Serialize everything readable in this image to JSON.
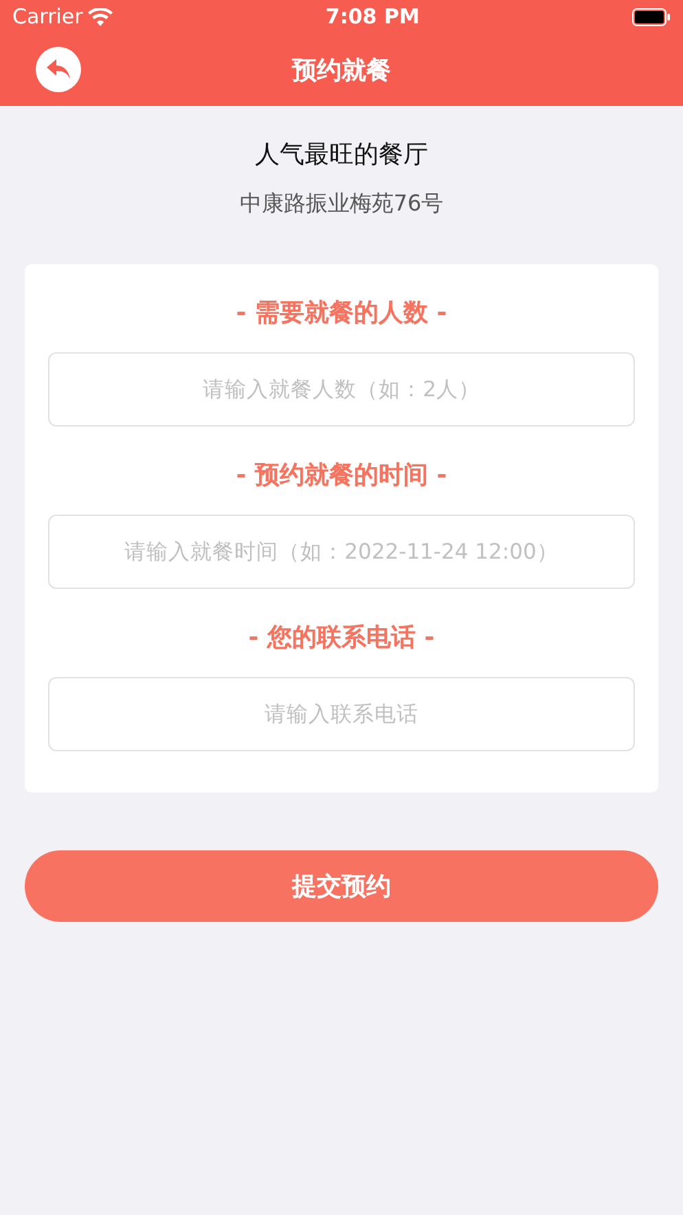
{
  "status_bar": {
    "carrier": "Carrier",
    "time": "7:08 PM"
  },
  "nav_bar": {
    "title": "预约就餐"
  },
  "restaurant": {
    "name": "人气最旺的餐厅",
    "address": "中康路振业梅苑76号"
  },
  "form": {
    "fields": [
      {
        "label": "- 需要就餐的人数 -",
        "placeholder": "请输入就餐人数（如：2人）"
      },
      {
        "label": "- 预约就餐的时间 -",
        "placeholder": "请输入就餐时间（如：2022-11-24 12:00）"
      },
      {
        "label": "- 您的联系电话 -",
        "placeholder": "请输入联系电话"
      }
    ]
  },
  "submit_button": "提交预约"
}
